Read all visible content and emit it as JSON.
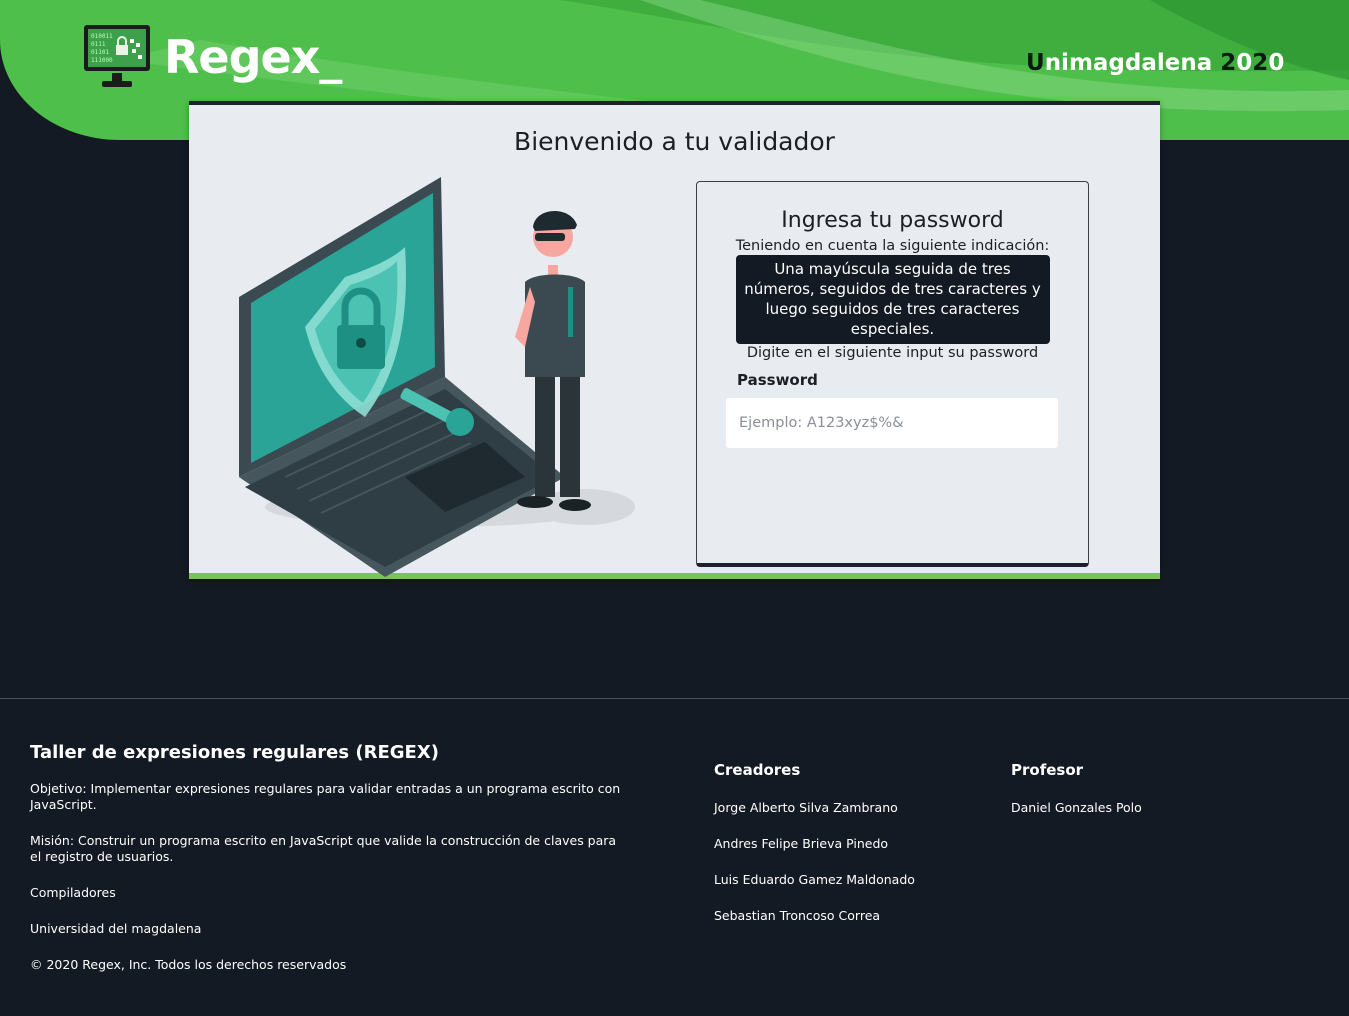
{
  "header": {
    "logo_title": "Regex_",
    "university_label": "Unimagdalena 2020"
  },
  "colors": {
    "header_green": "#4fbf4b",
    "page_bg": "#141a24",
    "accent_teal": "#26a69a",
    "card_bg": "#e8ebef"
  },
  "card": {
    "title": "Bienvenido a tu validador"
  },
  "form": {
    "title": "Ingresa tu password",
    "subtitle": "Teniendo en cuenta la siguiente indicación:",
    "rule": "Una mayúscula seguida de tres números, seguidos de tres caracteres y luego seguidos de tres caracteres especiales.",
    "instruction": "Digite en el siguiente input su password",
    "password_label": "Password",
    "password_placeholder": "Ejemplo: A123xyz$%&",
    "password_value": ""
  },
  "footer": {
    "title": "Taller de expresiones regulares (REGEX)",
    "objective": "Objetivo: Implementar expresiones regulares para validar entradas a un programa escrito con JavaScript.",
    "mission": "Misión: Construir un programa escrito en JavaScript que valide la construcción de claves para el registro de usuarios.",
    "course": "Compiladores",
    "university": "Universidad del magdalena",
    "copyright": "© 2020 Regex, Inc. Todos los derechos reservados",
    "creators_heading": "Creadores",
    "creators": [
      "Jorge Alberto Silva Zambrano",
      "Andres Felipe Brieva Pinedo",
      "Luis Eduardo Gamez Maldonado",
      "Sebastian Troncoso Correa"
    ],
    "professor_heading": "Profesor",
    "professor": "Daniel Gonzales Polo"
  },
  "icons": {
    "logo": "computer-lock-icon",
    "illustration": "laptop-security-guard-illustration"
  }
}
